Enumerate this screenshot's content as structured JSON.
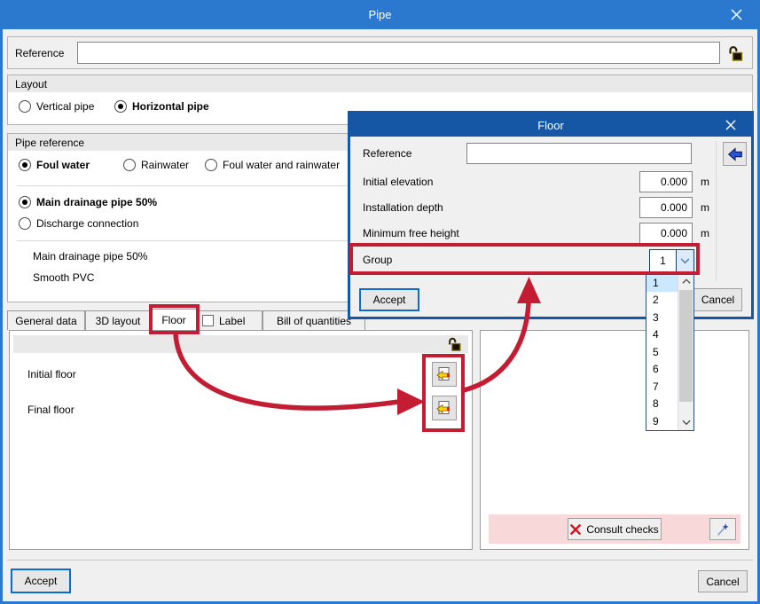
{
  "main_dialog": {
    "title": "Pipe",
    "reference_label": "Reference",
    "reference_value": "",
    "layout": {
      "title": "Layout",
      "options": [
        {
          "label": "Vertical pipe",
          "selected": false
        },
        {
          "label": "Horizontal pipe",
          "selected": true
        }
      ]
    },
    "pipe_reference": {
      "title": "Pipe reference",
      "water_options": [
        {
          "label": "Foul water",
          "selected": true
        },
        {
          "label": "Rainwater",
          "selected": false
        },
        {
          "label": "Foul water and rainwater",
          "selected": false
        }
      ],
      "type_options": [
        {
          "label": "Main drainage pipe 50%",
          "selected": true
        },
        {
          "label": "Discharge connection",
          "selected": false
        }
      ],
      "summary": [
        "Main drainage pipe 50%",
        "Smooth PVC"
      ]
    },
    "tabs": [
      {
        "label": "General data",
        "selected": false
      },
      {
        "label": "3D layout",
        "selected": false
      },
      {
        "label": "Floor",
        "selected": true
      },
      {
        "label": "Label",
        "selected": false
      },
      {
        "label": "Bill of quantities",
        "selected": false
      }
    ],
    "floor_panel": {
      "rows": [
        {
          "label": "Initial floor"
        },
        {
          "label": "Final floor"
        }
      ]
    },
    "checks_bar": {
      "consult_label": "Consult checks"
    },
    "accept_label": "Accept",
    "cancel_label": "Cancel"
  },
  "floor_dialog": {
    "title": "Floor",
    "reference_label": "Reference",
    "reference_value": "",
    "fields": [
      {
        "label": "Initial elevation",
        "value": "0.000",
        "unit": "m"
      },
      {
        "label": "Installation depth",
        "value": "0.000",
        "unit": "m"
      },
      {
        "label": "Minimum free height",
        "value": "0.000",
        "unit": "m"
      }
    ],
    "group_label": "Group",
    "group_value": "1",
    "dropdown": {
      "options": [
        "1",
        "2",
        "3",
        "4",
        "5",
        "6",
        "7",
        "8",
        "9"
      ],
      "selected": "1"
    },
    "accept_label": "Accept",
    "cancel_label": "Cancel"
  },
  "colors": {
    "main_titlebar": "#2a79cf",
    "floor_titlebar": "#1557a5",
    "annotation_red": "#c21d33",
    "checks_bar_pink": "#f9d8da",
    "selection_blue": "#cce8ff"
  }
}
